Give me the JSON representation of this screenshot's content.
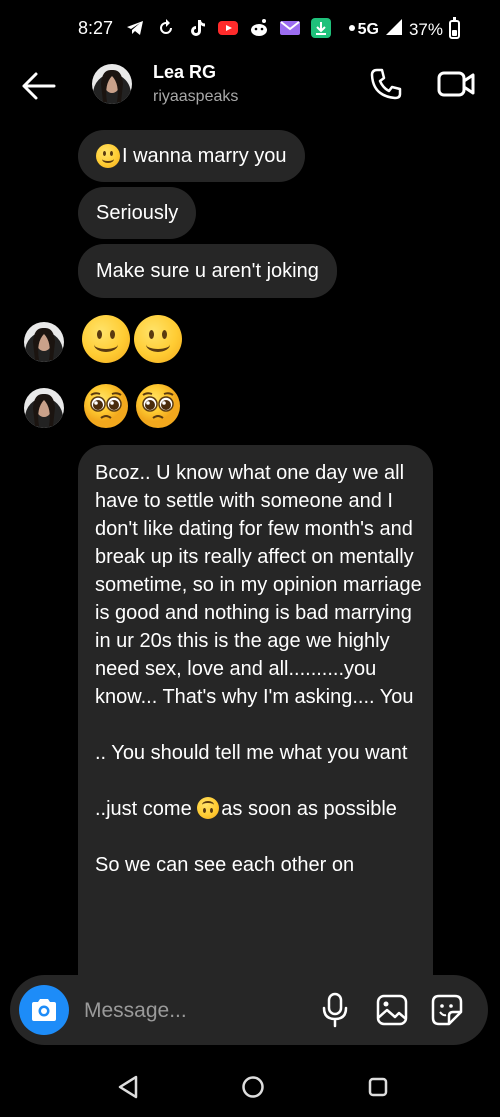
{
  "status_bar": {
    "time": "8:27",
    "network": "5G",
    "battery": "37%",
    "icons": [
      "telegram-icon",
      "sync-icon",
      "tiktok-icon",
      "youtube-icon",
      "reddit-icon",
      "mail-icon",
      "download-icon",
      "dot-icon"
    ]
  },
  "header": {
    "name": "Lea RG",
    "username": "riyaaspeaks"
  },
  "messages": [
    {
      "text": "I wanna marry you",
      "emoji": "slightly-smiling-face"
    },
    {
      "text": "Seriously"
    },
    {
      "text": "Make sure u aren't joking"
    }
  ],
  "emoji_messages": [
    {
      "emoji": [
        "slightly-smiling-face",
        "slightly-smiling-face"
      ]
    },
    {
      "emoji": [
        "pleading-face",
        "pleading-face"
      ]
    }
  ],
  "long_message": {
    "part1": "Bcoz.. U know what one day we all have to settle with someone and I don't like dating for few month's and break up its really affect on mentally sometime, so in my opinion marriage is good and nothing is bad marrying in ur 20s this is the age we highly need sex, love and all..........you know... That's why I'm asking.... You\n\n.. You should tell me what you want\n\n..just come ",
    "part2": "as soon as possible\n\nSo we can see each other on"
  },
  "composer": {
    "placeholder": "Message..."
  },
  "colors": {
    "background": "#000000",
    "bubble": "#262626",
    "accent": "#1d8cf8",
    "secondary_text": "#a8a8a8"
  }
}
